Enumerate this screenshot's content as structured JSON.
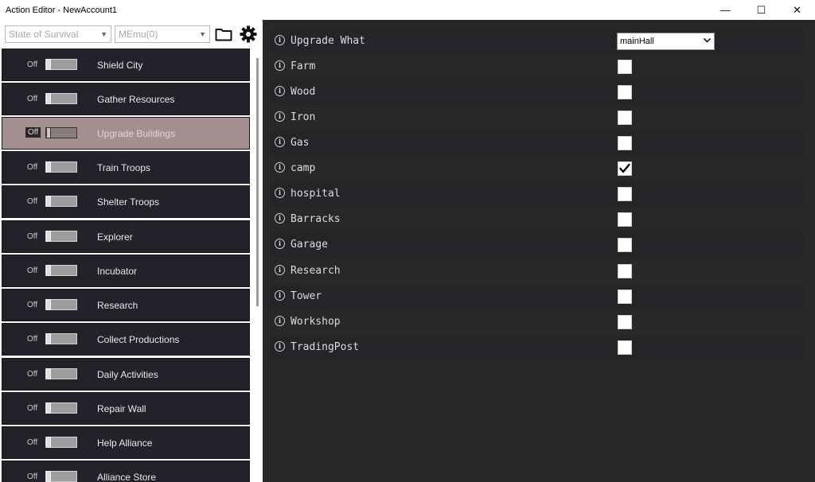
{
  "window": {
    "title": "Action Editor - NewAccount1",
    "minimize": "—",
    "maximize": "☐",
    "close": "✕"
  },
  "toolbar": {
    "game_select": "State of Survival",
    "emulator_select": "MEmu(0)",
    "folder_icon": "folder-icon",
    "settings_icon": "gear-icon"
  },
  "actions": [
    {
      "label": "Shield City",
      "toggle": "Off",
      "selected": false
    },
    {
      "label": "Gather Resources",
      "toggle": "Off",
      "selected": false
    },
    {
      "label": "Upgrade Buildings",
      "toggle": "Off",
      "selected": true
    },
    {
      "label": "Train Troops",
      "toggle": "Off",
      "selected": false
    },
    {
      "label": "Shelter Troops",
      "toggle": "Off",
      "selected": false
    },
    {
      "label": "Explorer",
      "toggle": "Off",
      "selected": false
    },
    {
      "label": "Incubator",
      "toggle": "Off",
      "selected": false
    },
    {
      "label": "Research",
      "toggle": "Off",
      "selected": false
    },
    {
      "label": "Collect Productions",
      "toggle": "Off",
      "selected": false
    },
    {
      "label": "Daily Activities",
      "toggle": "Off",
      "selected": false
    },
    {
      "label": "Repair Wall",
      "toggle": "Off",
      "selected": false
    },
    {
      "label": "Help Alliance",
      "toggle": "Off",
      "selected": false
    },
    {
      "label": "Alliance Store",
      "toggle": "Off",
      "selected": false
    }
  ],
  "settings": {
    "info_glyph": "i",
    "upgrade_what": {
      "label": "Upgrade What",
      "value": "mainHall"
    },
    "options": [
      {
        "label": "Farm",
        "checked": false
      },
      {
        "label": "Wood",
        "checked": false
      },
      {
        "label": "Iron",
        "checked": false
      },
      {
        "label": "Gas",
        "checked": false
      },
      {
        "label": "camp",
        "checked": true
      },
      {
        "label": "hospital",
        "checked": false
      },
      {
        "label": "Barracks",
        "checked": false
      },
      {
        "label": "Garage",
        "checked": false
      },
      {
        "label": "Research",
        "checked": false
      },
      {
        "label": "Tower",
        "checked": false
      },
      {
        "label": "Workshop",
        "checked": false
      },
      {
        "label": "TradingPost",
        "checked": false
      }
    ]
  }
}
